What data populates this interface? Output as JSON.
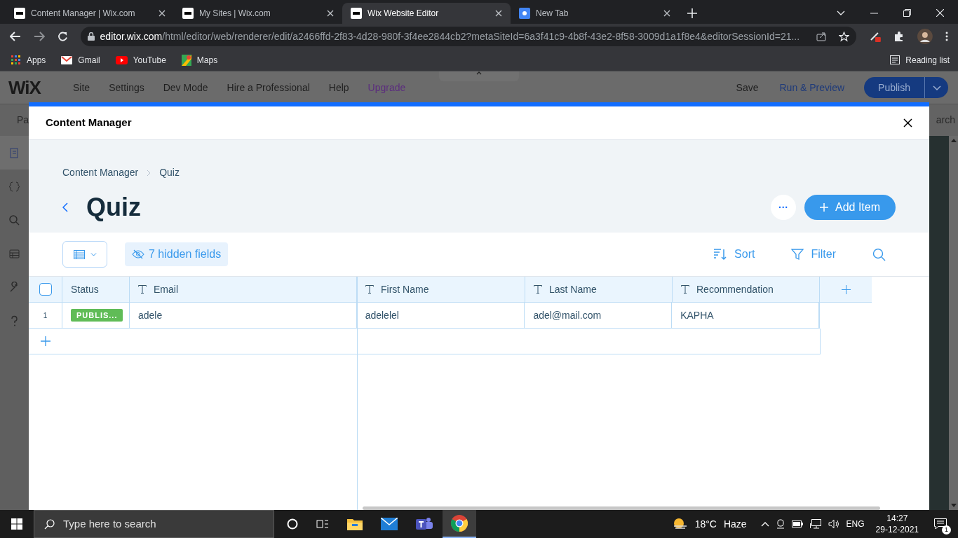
{
  "browser": {
    "tabs": [
      {
        "title": "Content Manager | Wix.com",
        "selected": false
      },
      {
        "title": "My Sites | Wix.com",
        "selected": false
      },
      {
        "title": "Wix Website Editor",
        "selected": true
      },
      {
        "title": "New Tab",
        "selected": false
      }
    ],
    "address": {
      "domain": "editor.wix.com",
      "path": "/html/editor/web/renderer/edit/a2466ffd-2f83-4d28-980f-3f4ee2844cb2?metaSiteId=6a3f41c9-4b8f-43e2-8f58-3009d1a1f8e4&editorSessionId=21..."
    },
    "bookmarks": [
      {
        "label": "Apps",
        "kind": "apps"
      },
      {
        "label": "Gmail",
        "kind": "mail"
      },
      {
        "label": "YouTube",
        "kind": "video"
      },
      {
        "label": "Maps",
        "kind": "maps"
      }
    ],
    "reading_list": "Reading list"
  },
  "editor": {
    "logo": "WiX",
    "menu": [
      {
        "label": "Site",
        "kind": "plain"
      },
      {
        "label": "Settings",
        "kind": "plain"
      },
      {
        "label": "Dev Mode",
        "kind": "plain"
      },
      {
        "label": "Hire a Professional",
        "kind": "plain"
      },
      {
        "label": "Help",
        "kind": "plain"
      },
      {
        "label": "Upgrade",
        "kind": "upgrade"
      }
    ],
    "save": "Save",
    "preview": "Run & Preview",
    "publish": "Publish",
    "sub_left": "Pa",
    "sub_right": "arch"
  },
  "modal": {
    "title": "Content Manager",
    "breadcrumbs": [
      "Content Manager",
      "Quiz"
    ],
    "heading": "Quiz",
    "add_button": "Add Item",
    "more_button": "···",
    "hidden_fields": "7 hidden fields",
    "actions": [
      {
        "label": "Sort",
        "kind": "sort"
      },
      {
        "label": "Filter",
        "kind": "filter"
      }
    ],
    "table": {
      "select_all_checked": false,
      "columns": [
        {
          "label": "Status",
          "kind": "status"
        },
        {
          "label": "Email",
          "kind": "text"
        },
        {
          "label": "First Name",
          "kind": "text"
        },
        {
          "label": "Last Name",
          "kind": "text"
        },
        {
          "label": "Recommendation",
          "kind": "text"
        }
      ],
      "rows": [
        {
          "number": "1",
          "cells": [
            "PUBLIS...",
            "adele",
            "adelelel",
            "adel@mail.com",
            "KAPHA"
          ]
        }
      ]
    }
  },
  "taskbar": {
    "search_placeholder": "Type here to search",
    "temperature": "18°C",
    "weather": "Haze",
    "language": "ENG",
    "time": "14:27",
    "date": "29-12-2021",
    "notifications": "1"
  }
}
